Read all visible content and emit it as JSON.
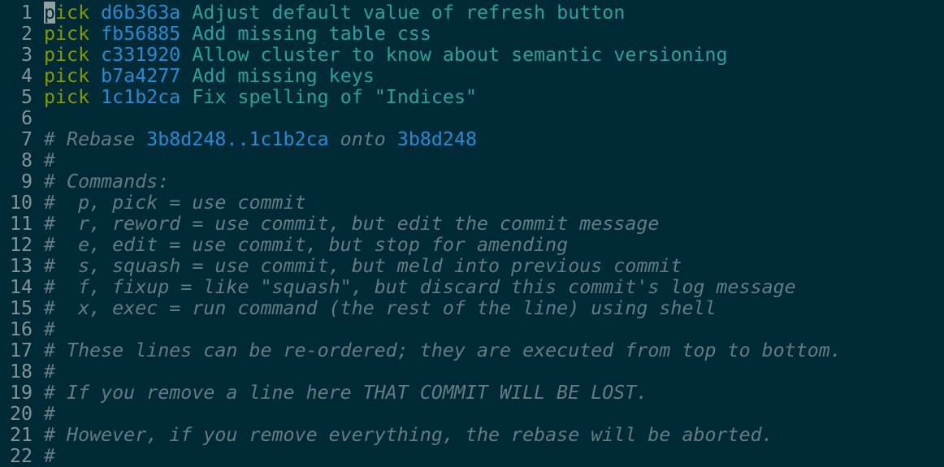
{
  "editor": {
    "lines": [
      {
        "n": "1",
        "kind": "pick",
        "cmd": "pick",
        "hash": "d6b363a",
        "msg": "Adjust default value of refresh button"
      },
      {
        "n": "2",
        "kind": "pick",
        "cmd": "pick",
        "hash": "fb56885",
        "msg": "Add missing table css"
      },
      {
        "n": "3",
        "kind": "pick",
        "cmd": "pick",
        "hash": "c331920",
        "msg": "Allow cluster to know about semantic versioning"
      },
      {
        "n": "4",
        "kind": "pick",
        "cmd": "pick",
        "hash": "b7a4277",
        "msg": "Add missing keys"
      },
      {
        "n": "5",
        "kind": "pick",
        "cmd": "pick",
        "hash": "1c1b2ca",
        "msg": "Fix spelling of \"Indices\""
      },
      {
        "n": "6",
        "kind": "blank"
      },
      {
        "n": "7",
        "kind": "rebase",
        "prefix": "# Rebase ",
        "range": "3b8d248..1c1b2ca",
        "mid": " onto ",
        "onto": "3b8d248"
      },
      {
        "n": "8",
        "kind": "comment",
        "text": "#"
      },
      {
        "n": "9",
        "kind": "comment",
        "text": "# Commands:"
      },
      {
        "n": "10",
        "kind": "comment",
        "text": "#  p, pick = use commit"
      },
      {
        "n": "11",
        "kind": "comment",
        "text": "#  r, reword = use commit, but edit the commit message"
      },
      {
        "n": "12",
        "kind": "comment",
        "text": "#  e, edit = use commit, but stop for amending"
      },
      {
        "n": "13",
        "kind": "comment",
        "text": "#  s, squash = use commit, but meld into previous commit"
      },
      {
        "n": "14",
        "kind": "comment",
        "text": "#  f, fixup = like \"squash\", but discard this commit's log message"
      },
      {
        "n": "15",
        "kind": "comment",
        "text": "#  x, exec = run command (the rest of the line) using shell"
      },
      {
        "n": "16",
        "kind": "comment",
        "text": "#"
      },
      {
        "n": "17",
        "kind": "comment",
        "text": "# These lines can be re-ordered; they are executed from top to bottom."
      },
      {
        "n": "18",
        "kind": "comment",
        "text": "#"
      },
      {
        "n": "19",
        "kind": "comment",
        "text": "# If you remove a line here THAT COMMIT WILL BE LOST."
      },
      {
        "n": "20",
        "kind": "comment",
        "text": "#"
      },
      {
        "n": "21",
        "kind": "comment",
        "text": "# However, if you remove everything, the rebase will be aborted."
      },
      {
        "n": "22",
        "kind": "comment",
        "text": "#"
      }
    ]
  },
  "colors": {
    "background": "#002b36",
    "line_number": "#839496",
    "keyword": "#859900",
    "hash": "#268bd2",
    "message": "#2aa198",
    "comment": "#657b83"
  }
}
